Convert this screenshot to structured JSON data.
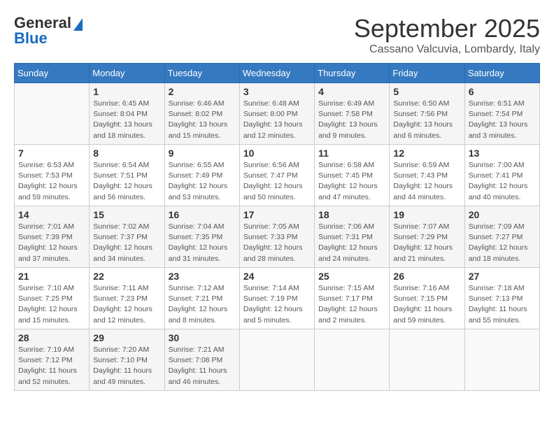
{
  "logo": {
    "line1": "General",
    "line2": "Blue"
  },
  "title": "September 2025",
  "subtitle": "Cassano Valcuvia, Lombardy, Italy",
  "headers": [
    "Sunday",
    "Monday",
    "Tuesday",
    "Wednesday",
    "Thursday",
    "Friday",
    "Saturday"
  ],
  "weeks": [
    [
      {
        "day": "",
        "info": ""
      },
      {
        "day": "1",
        "info": "Sunrise: 6:45 AM\nSunset: 8:04 PM\nDaylight: 13 hours\nand 18 minutes."
      },
      {
        "day": "2",
        "info": "Sunrise: 6:46 AM\nSunset: 8:02 PM\nDaylight: 13 hours\nand 15 minutes."
      },
      {
        "day": "3",
        "info": "Sunrise: 6:48 AM\nSunset: 8:00 PM\nDaylight: 13 hours\nand 12 minutes."
      },
      {
        "day": "4",
        "info": "Sunrise: 6:49 AM\nSunset: 7:58 PM\nDaylight: 13 hours\nand 9 minutes."
      },
      {
        "day": "5",
        "info": "Sunrise: 6:50 AM\nSunset: 7:56 PM\nDaylight: 13 hours\nand 6 minutes."
      },
      {
        "day": "6",
        "info": "Sunrise: 6:51 AM\nSunset: 7:54 PM\nDaylight: 13 hours\nand 3 minutes."
      }
    ],
    [
      {
        "day": "7",
        "info": "Sunrise: 6:53 AM\nSunset: 7:53 PM\nDaylight: 12 hours\nand 59 minutes."
      },
      {
        "day": "8",
        "info": "Sunrise: 6:54 AM\nSunset: 7:51 PM\nDaylight: 12 hours\nand 56 minutes."
      },
      {
        "day": "9",
        "info": "Sunrise: 6:55 AM\nSunset: 7:49 PM\nDaylight: 12 hours\nand 53 minutes."
      },
      {
        "day": "10",
        "info": "Sunrise: 6:56 AM\nSunset: 7:47 PM\nDaylight: 12 hours\nand 50 minutes."
      },
      {
        "day": "11",
        "info": "Sunrise: 6:58 AM\nSunset: 7:45 PM\nDaylight: 12 hours\nand 47 minutes."
      },
      {
        "day": "12",
        "info": "Sunrise: 6:59 AM\nSunset: 7:43 PM\nDaylight: 12 hours\nand 44 minutes."
      },
      {
        "day": "13",
        "info": "Sunrise: 7:00 AM\nSunset: 7:41 PM\nDaylight: 12 hours\nand 40 minutes."
      }
    ],
    [
      {
        "day": "14",
        "info": "Sunrise: 7:01 AM\nSunset: 7:39 PM\nDaylight: 12 hours\nand 37 minutes."
      },
      {
        "day": "15",
        "info": "Sunrise: 7:02 AM\nSunset: 7:37 PM\nDaylight: 12 hours\nand 34 minutes."
      },
      {
        "day": "16",
        "info": "Sunrise: 7:04 AM\nSunset: 7:35 PM\nDaylight: 12 hours\nand 31 minutes."
      },
      {
        "day": "17",
        "info": "Sunrise: 7:05 AM\nSunset: 7:33 PM\nDaylight: 12 hours\nand 28 minutes."
      },
      {
        "day": "18",
        "info": "Sunrise: 7:06 AM\nSunset: 7:31 PM\nDaylight: 12 hours\nand 24 minutes."
      },
      {
        "day": "19",
        "info": "Sunrise: 7:07 AM\nSunset: 7:29 PM\nDaylight: 12 hours\nand 21 minutes."
      },
      {
        "day": "20",
        "info": "Sunrise: 7:09 AM\nSunset: 7:27 PM\nDaylight: 12 hours\nand 18 minutes."
      }
    ],
    [
      {
        "day": "21",
        "info": "Sunrise: 7:10 AM\nSunset: 7:25 PM\nDaylight: 12 hours\nand 15 minutes."
      },
      {
        "day": "22",
        "info": "Sunrise: 7:11 AM\nSunset: 7:23 PM\nDaylight: 12 hours\nand 12 minutes."
      },
      {
        "day": "23",
        "info": "Sunrise: 7:12 AM\nSunset: 7:21 PM\nDaylight: 12 hours\nand 8 minutes."
      },
      {
        "day": "24",
        "info": "Sunrise: 7:14 AM\nSunset: 7:19 PM\nDaylight: 12 hours\nand 5 minutes."
      },
      {
        "day": "25",
        "info": "Sunrise: 7:15 AM\nSunset: 7:17 PM\nDaylight: 12 hours\nand 2 minutes."
      },
      {
        "day": "26",
        "info": "Sunrise: 7:16 AM\nSunset: 7:15 PM\nDaylight: 11 hours\nand 59 minutes."
      },
      {
        "day": "27",
        "info": "Sunrise: 7:18 AM\nSunset: 7:13 PM\nDaylight: 11 hours\nand 55 minutes."
      }
    ],
    [
      {
        "day": "28",
        "info": "Sunrise: 7:19 AM\nSunset: 7:12 PM\nDaylight: 11 hours\nand 52 minutes."
      },
      {
        "day": "29",
        "info": "Sunrise: 7:20 AM\nSunset: 7:10 PM\nDaylight: 11 hours\nand 49 minutes."
      },
      {
        "day": "30",
        "info": "Sunrise: 7:21 AM\nSunset: 7:08 PM\nDaylight: 11 hours\nand 46 minutes."
      },
      {
        "day": "",
        "info": ""
      },
      {
        "day": "",
        "info": ""
      },
      {
        "day": "",
        "info": ""
      },
      {
        "day": "",
        "info": ""
      }
    ]
  ]
}
